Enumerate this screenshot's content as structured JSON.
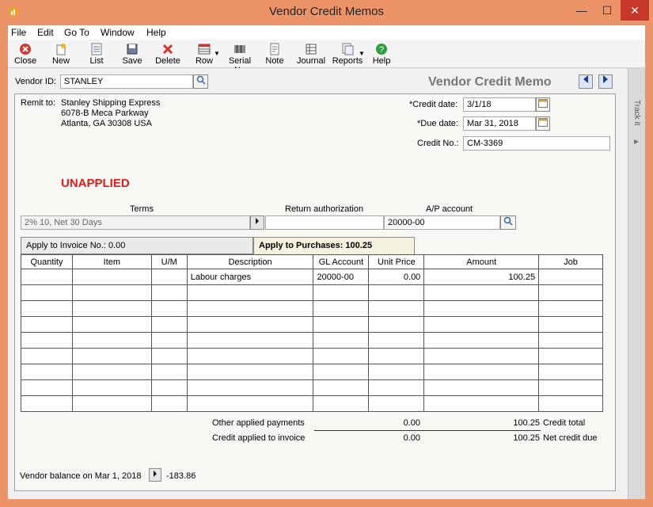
{
  "window": {
    "title": "Vendor Credit Memos",
    "minimize": "—",
    "maximize": "☐",
    "close": "✕"
  },
  "menu": [
    "File",
    "Edit",
    "Go To",
    "Window",
    "Help"
  ],
  "toolbar": {
    "close": "Close",
    "new": "New",
    "list": "List",
    "save": "Save",
    "delete": "Delete",
    "row": "Row",
    "serial": "Serial No",
    "note": "Note",
    "journal": "Journal",
    "reports": "Reports",
    "help": "Help"
  },
  "header": {
    "vendor_label": "Vendor ID:",
    "vendor_value": "STANLEY",
    "form_title": "Vendor Credit Memo",
    "track_it": "Track it"
  },
  "remit": {
    "label": "Remit to:",
    "line1": "Stanley Shipping Express",
    "line2": "6078-B Meca Parkway",
    "line3": "Atlanta, GA 30308 USA"
  },
  "dates": {
    "credit_date_label": "*Credit date:",
    "credit_date_value": "3/1/18",
    "due_date_label": "*Due date:",
    "due_date_value": "Mar 31, 2018",
    "credit_no_label": "Credit No.:",
    "credit_no_value": "CM-3369"
  },
  "status": "UNAPPLIED",
  "terms": {
    "terms_label": "Terms",
    "terms_value": "2% 10, Net 30 Days",
    "return_label": "Return authorization",
    "return_value": "",
    "ap_label": "A/P account",
    "ap_value": "20000-00"
  },
  "tabs": {
    "invoice": "Apply to Invoice No.: 0.00",
    "purchases": "Apply to Purchases: 100.25"
  },
  "grid": {
    "columns": [
      "Quantity",
      "Item",
      "U/M",
      "Description",
      "GL Account",
      "Unit Price",
      "Amount",
      "Job"
    ],
    "row1": {
      "quantity": "",
      "item": "",
      "um": "",
      "description": "Labour charges",
      "gl": "20000-00",
      "unit_price": "0.00",
      "amount": "100.25",
      "job": ""
    }
  },
  "totals": {
    "other_label": "Other applied payments",
    "other_value": "0.00",
    "credit_total_value": "100.25",
    "credit_total_label": "Credit total",
    "applied_label": "Credit applied to invoice",
    "applied_value": "0.00",
    "net_value": "100.25",
    "net_label": "Net credit due"
  },
  "footer": {
    "balance_label": "Vendor balance on Mar 1, 2018",
    "balance_value": "-183.86"
  }
}
